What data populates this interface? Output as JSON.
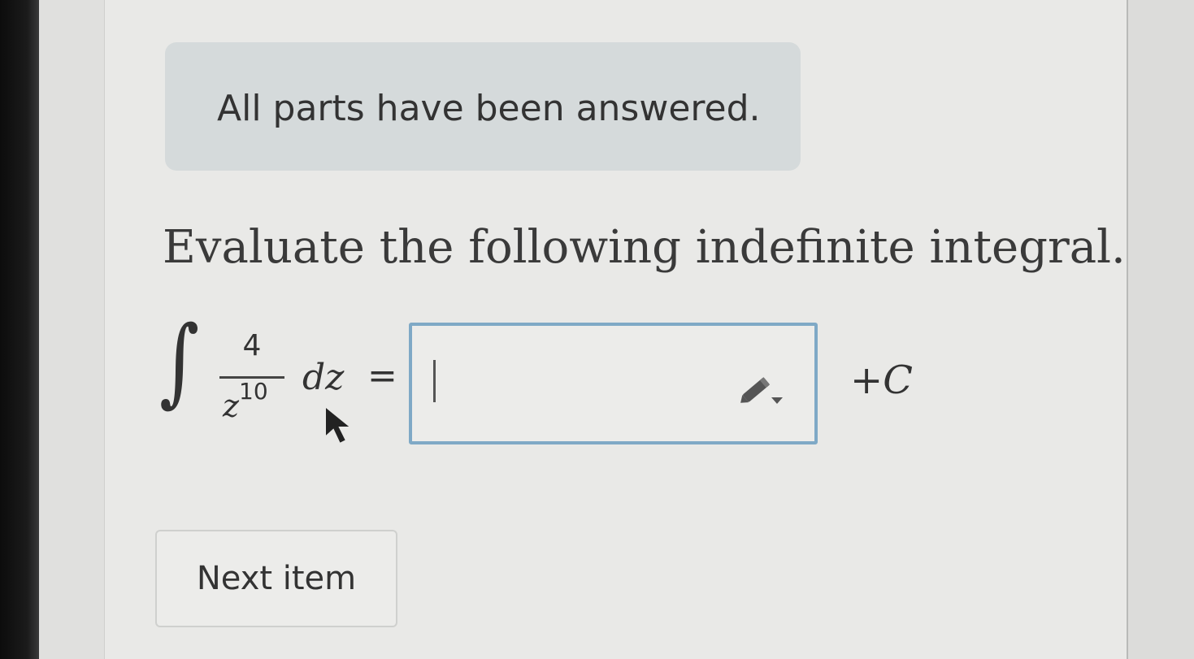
{
  "status": {
    "message": "All parts have been answered."
  },
  "question": {
    "instruction": "Evaluate the following indefinite integral.",
    "integral_sign": "∫",
    "numerator": "4",
    "denominator_var": "z",
    "denominator_exp": "10",
    "differential": "dz",
    "equals": "=",
    "constant": "+C"
  },
  "answer": {
    "value": "",
    "tool_icon": "pencil-dropdown-icon"
  },
  "actions": {
    "next_label": "Next item"
  },
  "colors": {
    "page_background": "#e9e9e7",
    "banner_background": "#d5dadb",
    "input_border": "#7fa9c6",
    "text": "#333333"
  }
}
